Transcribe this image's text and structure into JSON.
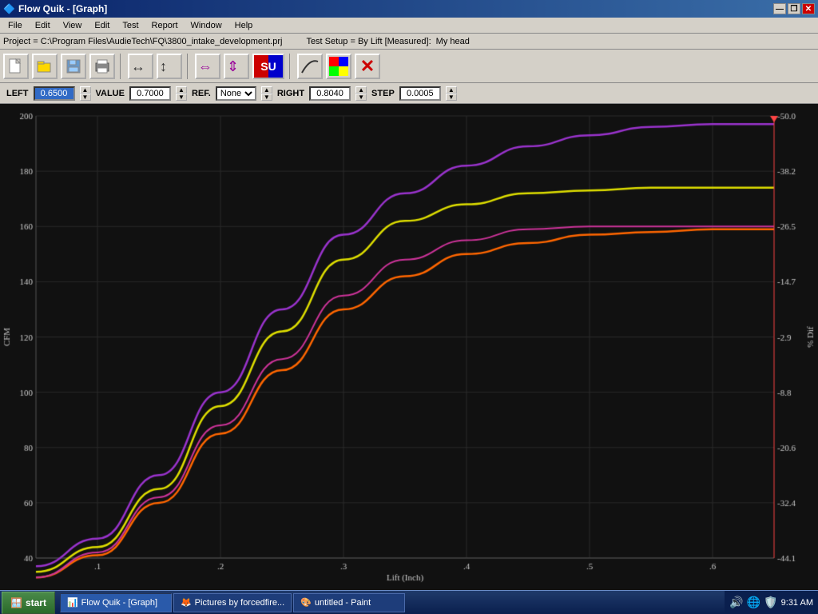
{
  "window": {
    "title": "Flow Quik - [Graph]",
    "app_icon": "⬛"
  },
  "title_buttons": {
    "minimize": "—",
    "restore": "❐",
    "close": "✕"
  },
  "menu": {
    "items": [
      "File",
      "Edit",
      "View",
      "Edit",
      "Test",
      "Report",
      "Window",
      "Help"
    ]
  },
  "status": {
    "project_path": "Project = C:\\Program Files\\AudieTech\\FQ\\3800_intake_development.prj",
    "test_setup": "Test Setup = By Lift [Measured]:",
    "head": "My head"
  },
  "controls": {
    "left_label": "LEFT",
    "left_value": "0.6500",
    "value_label": "VALUE",
    "value_value": "0.7000",
    "ref_label": "REF.",
    "ref_value": "None",
    "right_label": "RIGHT",
    "right_value": "0.8040",
    "step_label": "STEP",
    "step_value": "0.0005"
  },
  "graph": {
    "y_axis_label": "CFM",
    "x_axis_label": "Lift (Inch)",
    "y_right_label": "% Dif",
    "y_ticks": [
      40,
      60,
      80,
      100,
      120,
      140,
      160,
      180,
      200
    ],
    "x_ticks": [
      0.1,
      0.2,
      0.3,
      0.4,
      0.5,
      0.6
    ],
    "y_right_ticks": [
      -44.1,
      -32.4,
      -20.6,
      -8.8,
      -2.9,
      -14.7,
      -26.5,
      -38.2,
      -50.0
    ],
    "y_right_display": [
      "-50.0",
      "-38.2",
      "-26.5",
      "-14.7",
      "-2.9",
      "-8.8",
      "-20.6",
      "-32.4",
      "-44.1"
    ],
    "cursor_value": "0.6500",
    "colors": {
      "purple": "#9933cc",
      "yellow": "#ffff00",
      "pink": "#cc3399",
      "orange": "#ff6600",
      "grid": "#2a2a2a",
      "background": "#111111"
    }
  },
  "taskbar": {
    "start_label": "start",
    "apps": [
      {
        "label": "Flow Quik - [Graph]",
        "icon": "📊",
        "active": true
      },
      {
        "label": "Pictures by forcedfire...",
        "icon": "🦊",
        "active": false
      },
      {
        "label": "untitled - Paint",
        "icon": "🎨",
        "active": false
      }
    ],
    "time": "9:31 AM"
  }
}
